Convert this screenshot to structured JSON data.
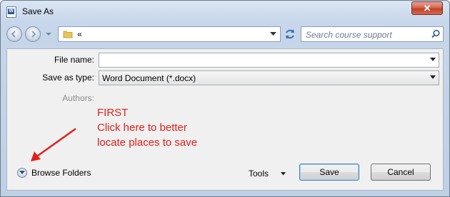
{
  "window": {
    "title": "Save As",
    "close_glyph": "✕"
  },
  "nav": {
    "breadcrumb": "«",
    "search_placeholder": "Search course support"
  },
  "form": {
    "file_name_label": "File name:",
    "file_name_value": "",
    "save_type_label": "Save as type:",
    "save_type_value": "Word Document (*.docx)",
    "authors_label": "Authors:"
  },
  "annotation": {
    "line1": "FIRST",
    "line2": "Click here to better",
    "line3": "locate places to save",
    "color": "#e0201a"
  },
  "footer": {
    "browse_label": "Browse Folders",
    "tools_label": "Tools",
    "save_label": "Save",
    "cancel_label": "Cancel"
  },
  "icons": [
    "word-doc-icon",
    "close-icon",
    "back-arrow-icon",
    "forward-arrow-icon",
    "chevron-down-icon",
    "folder-icon",
    "refresh-icon",
    "search-icon",
    "expand-chevron-icon"
  ]
}
